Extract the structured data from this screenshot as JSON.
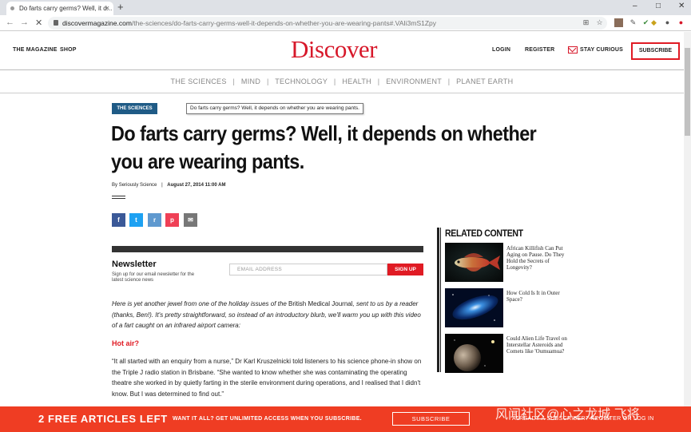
{
  "browser": {
    "tab_title": "Do farts carry germs? Well, it d...",
    "tab_close": "×",
    "new_tab": "+",
    "minimize": "–",
    "maximize": "□",
    "close": "✕",
    "back": "←",
    "forward": "→",
    "reload": "✕",
    "url_host": "discovermagazine.com",
    "url_path": "/the-sciences/do-farts-carry-germs-well-it-depends-on-whether-you-are-wearing-pants#.VAIi3mS1Zpy"
  },
  "header": {
    "the_magazine": "THE MAGAZINE",
    "shop": "SHOP",
    "logo": "Discover",
    "login": "LOGIN",
    "register": "REGISTER",
    "stay_curious": "STAY CURIOUS",
    "subscribe": "SUBSCRIBE"
  },
  "section_nav": {
    "items": [
      "THE SCIENCES",
      "MIND",
      "TECHNOLOGY",
      "HEALTH",
      "ENVIRONMENT",
      "PLANET EARTH"
    ],
    "separator": "|"
  },
  "article": {
    "category": "THE SCIENCES",
    "tooltip": "Do farts carry germs? Well, it depends on whether you are wearing pants.",
    "headline": "Do farts carry germs? Well, it depends on whether you are wearing pants.",
    "byline_prefix": "By",
    "author": "Seriously Science",
    "date": "August 27, 2014 11:00 AM",
    "intro_a": "Here is yet another jewel from one of the holiday issues of the ",
    "intro_b": "British Medical Journal",
    "intro_c": ", sent to us by a reader (thanks, Ben!). It's pretty straightforward, so instead of an introductory blurb, we'll warm you up with this video of a fart caught on an infrared airport camera:",
    "subhead": "Hot air?",
    "para2": "“It all started with an enquiry from a nurse,” Dr Karl Kruszelnicki told listeners to his science phone-in show on the Triple J radio station in Brisbane. “She wanted to know whether she was contaminating the operating theatre she worked in by quietly farting in the sterile environment during operations, and I realised that I didn't know. But I was determined to find out.”"
  },
  "share": {
    "facebook": "f",
    "twitter": "t",
    "reddit": "r",
    "pocket": "p",
    "email": "✉"
  },
  "newsletter": {
    "title": "Newsletter",
    "subtitle": "Sign up for our email newsletter for the latest science news",
    "placeholder": "EMAIL ADDRESS",
    "button": "SIGN UP"
  },
  "related": {
    "title": "RELATED CONTENT",
    "items": [
      {
        "title": "African Killifish Can Put Aging on Pause. Do They Hold the Secrets of Longevity?"
      },
      {
        "title": "How Cold Is It in Outer Space?"
      },
      {
        "title": "Could Alien Life Travel on Interstellar Asteroids and Comets like 'Oumuamua?"
      }
    ]
  },
  "paywall": {
    "left": "2 FREE ARTICLES LEFT",
    "mid": "WANT IT ALL? GET UNLIMITED ACCESS WHEN YOU SUBSCRIBE.",
    "button": "SUBSCRIBE",
    "right": "ALREADY A SUBSCRIBER? REGISTER OR LOG IN"
  },
  "watermark": "风闻社区@心之龙城  飞将"
}
